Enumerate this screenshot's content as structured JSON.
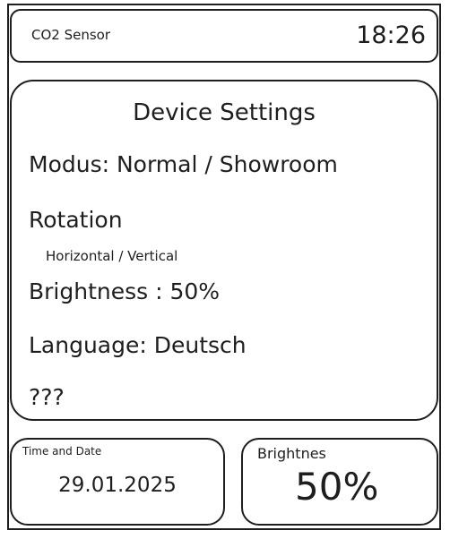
{
  "header": {
    "title": "CO2 Sensor",
    "time": "18:26"
  },
  "settings": {
    "title": "Device Settings",
    "modus": "Modus: Normal / Showroom",
    "rotation": "Rotation",
    "rotation_options": "Horizontal / Vertical",
    "brightness": "Brightness : 50%",
    "language": "Language: Deutsch",
    "other": "???"
  },
  "widgets": {
    "datetime": {
      "label": "Time and Date",
      "value": "29.01.2025"
    },
    "brightness": {
      "label": "Brightnes",
      "value": "50%"
    }
  }
}
